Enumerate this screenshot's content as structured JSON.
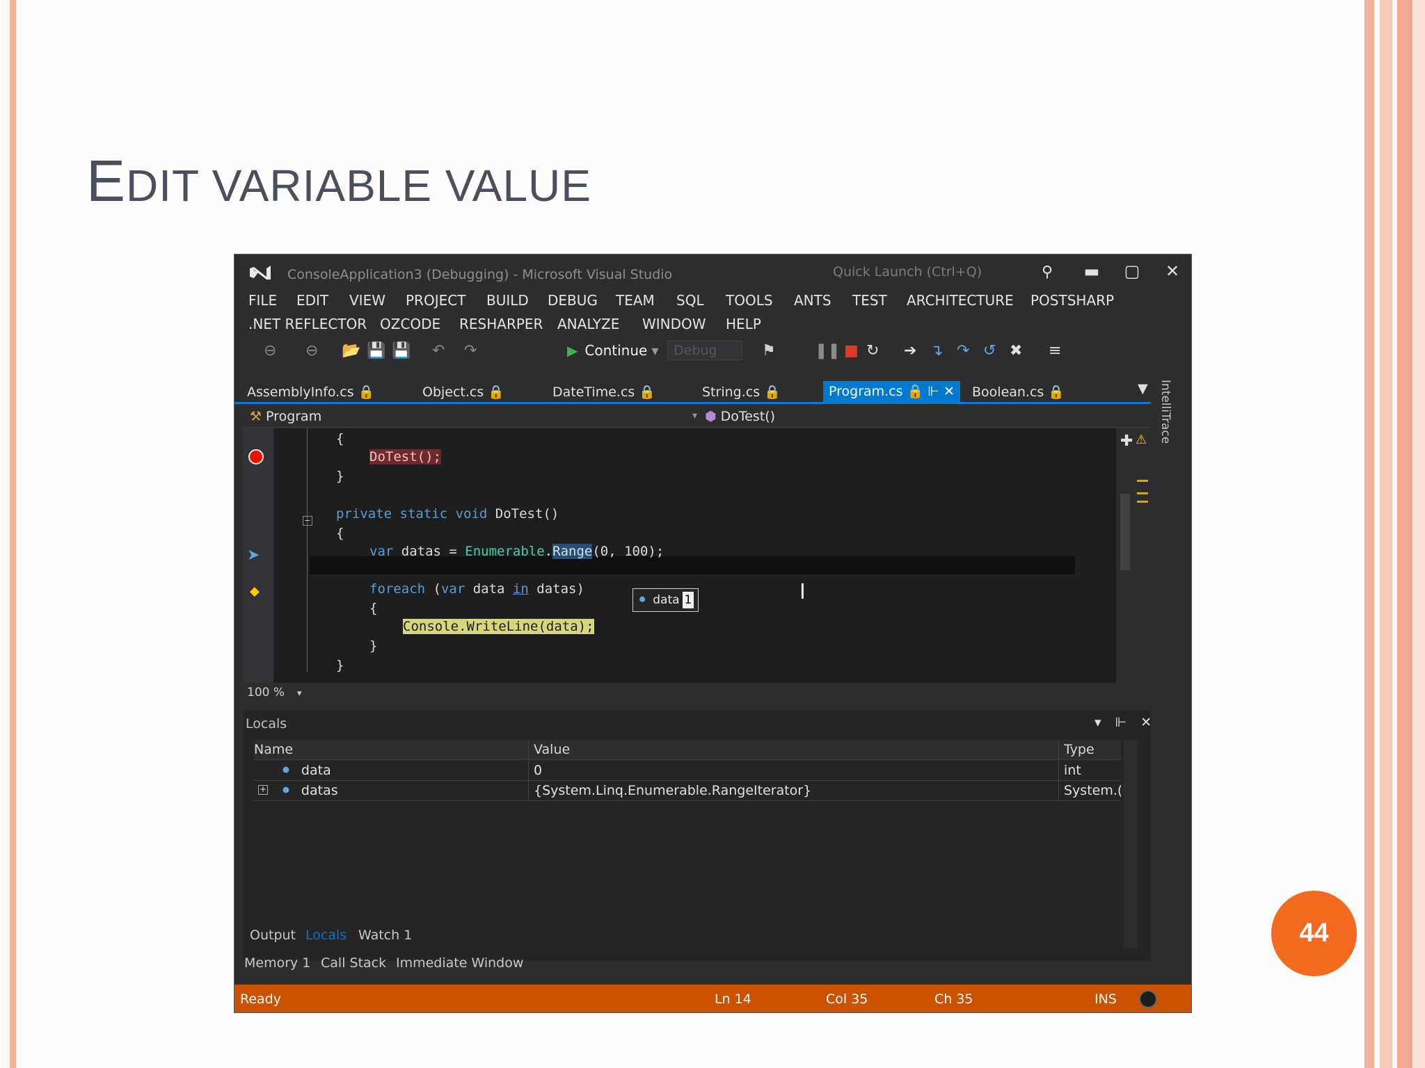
{
  "slide": {
    "title_first_letter": "E",
    "title_rest": "DIT VARIABLE VALUE",
    "page_number": "44"
  },
  "window": {
    "title": "ConsoleApplication3 (Debugging) - Microsoft Visual Studio",
    "quick_launch_placeholder": "Quick Launch (Ctrl+Q)"
  },
  "menu": {
    "row1": [
      "FILE",
      "EDIT",
      "VIEW",
      "PROJECT",
      "BUILD",
      "DEBUG",
      "TEAM",
      "SQL",
      "TOOLS",
      "ANTS",
      "TEST",
      "ARCHITECTURE",
      "POSTSHARP"
    ],
    "row2": [
      ".NET REFLECTOR",
      "OZCODE",
      "RESHARPER",
      "ANALYZE",
      "WINDOW",
      "HELP"
    ]
  },
  "toolbar": {
    "continue_label": "Continue",
    "config_value": "Debug"
  },
  "tabs": [
    {
      "label": "AssemblyInfo.cs"
    },
    {
      "label": "Object.cs"
    },
    {
      "label": "DateTime.cs"
    },
    {
      "label": "String.cs"
    },
    {
      "label": "Program.cs",
      "active": true
    },
    {
      "label": "Boolean.cs"
    }
  ],
  "side_label": "IntelliTrace",
  "navbar": {
    "type_value": "Program",
    "member_value": "DoTest()"
  },
  "code": {
    "line_open1": "{",
    "call": "DoTest();",
    "line_close1": "}",
    "method_decl_kw": "private static void",
    "method_decl_name": " DoTest()",
    "line_open2": "{",
    "var_kw": "var",
    "var_rest": " datas = ",
    "enumerable": "Enumerable",
    "dot": ".",
    "range": "Range",
    "args": "(0, 100);",
    "foreach_kw": "foreach",
    "foreach_mid1": " (",
    "foreach_var": "var",
    "foreach_mid2": " data ",
    "foreach_in": "in",
    "foreach_end": " datas)",
    "line_open3": "{",
    "console_line": "Console.WriteLine(data);",
    "line_close3": "}",
    "line_close2": "}"
  },
  "datatip": {
    "name": "data",
    "value": "1"
  },
  "zoom_level": "100 %",
  "locals": {
    "title": "Locals",
    "columns": [
      "Name",
      "Value",
      "Type"
    ],
    "rows": [
      {
        "name": "data",
        "value": "0",
        "type": "int"
      },
      {
        "name": "datas",
        "value": "{System.Linq.Enumerable.RangeIterator}",
        "type": "System.("
      }
    ]
  },
  "panel_tabs": {
    "row1": [
      "Output",
      "Locals",
      "Watch 1"
    ],
    "row2": [
      "Memory 1",
      "Call Stack",
      "Immediate Window"
    ]
  },
  "status": {
    "state": "Ready",
    "line": "Ln 14",
    "col": "Col 35",
    "ch": "Ch 35",
    "mode": "INS"
  },
  "colors": {
    "accent": "#007acc",
    "status_bar": "#ca5100",
    "page_badge": "#f26b21",
    "breakpoint": "#e51400"
  }
}
